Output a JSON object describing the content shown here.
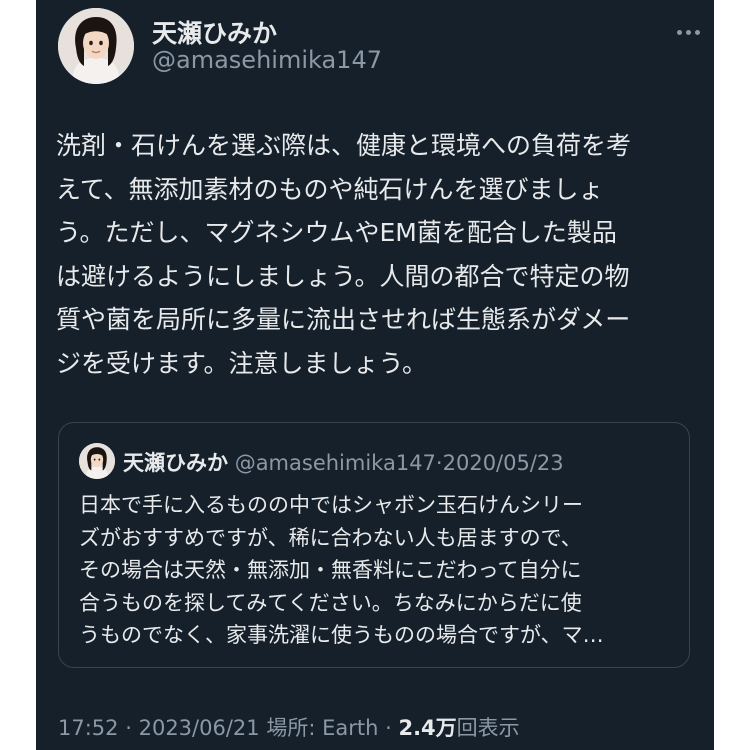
{
  "author": {
    "display_name": "天瀬ひみか",
    "handle": "@amasehimika147",
    "avatar": "profile-photo"
  },
  "more_icon": "three-dots-icon",
  "tweet": {
    "lines": [
      "洗剤・石けんを選ぶ際は、健康と環境への負荷を考",
      "えて、無添加素材のものや純石けんを選びましょ",
      "う。ただし、マグネシウムやEM菌を配合した製品",
      "は避けるようにしましょう。人間の都合で特定の物",
      "質や菌を局所に多量に流出させれば生態系がダメー",
      "ジを受けます。注意しましょう。"
    ]
  },
  "quote": {
    "display_name": "天瀬ひみか",
    "handle": "@amasehimika147",
    "separator": "·",
    "date": "2020/05/23",
    "lines": [
      "日本で手に入るものの中ではシャボン玉石けんシリー",
      "ズがおすすめですが、稀に合わない人も居ますので、",
      "その場合は天然・無添加・無香料にこだわって自分に",
      "合うものを探してみてください。ちなみにからだに使",
      "うものでなく、家事洗濯に使うものの場合ですが、マ…"
    ]
  },
  "meta": {
    "time": "17:52",
    "separator": "·",
    "date": "2023/06/21",
    "location": "場所: Earth",
    "separator2": "·",
    "views_count": "2.4万",
    "views_label": "回表示"
  },
  "colors": {
    "background": "#15202b",
    "outer": "#ffffff",
    "text_primary": "#e7e9ea",
    "text_secondary": "#8b98a5",
    "border": "#38444d"
  }
}
